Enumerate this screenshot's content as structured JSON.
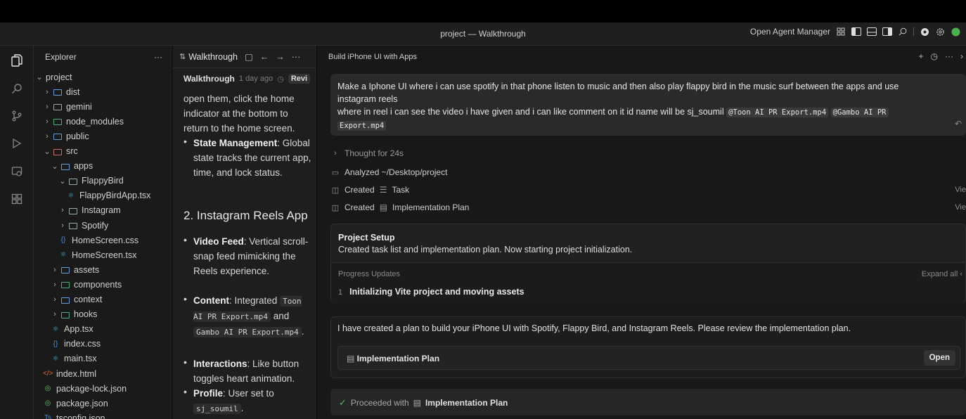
{
  "window": {
    "title": "project — Walkthrough",
    "open_agent_manager": "Open Agent Manager"
  },
  "explorer": {
    "title": "Explorer",
    "more": "···",
    "tree": [
      {
        "label": "project",
        "depth": 0,
        "kind": "folder-open"
      },
      {
        "label": "dist",
        "depth": 1,
        "kind": "folder"
      },
      {
        "label": "gemini",
        "depth": 1,
        "kind": "folder"
      },
      {
        "label": "node_modules",
        "depth": 1,
        "kind": "folder"
      },
      {
        "label": "public",
        "depth": 1,
        "kind": "folder"
      },
      {
        "label": "src",
        "depth": 1,
        "kind": "folder-open"
      },
      {
        "label": "apps",
        "depth": 2,
        "kind": "folder-open"
      },
      {
        "label": "FlappyBird",
        "depth": 3,
        "kind": "folder-open"
      },
      {
        "label": "FlappyBirdApp.tsx",
        "depth": 4,
        "kind": "tsx"
      },
      {
        "label": "Instagram",
        "depth": 3,
        "kind": "folder"
      },
      {
        "label": "Spotify",
        "depth": 3,
        "kind": "folder"
      },
      {
        "label": "HomeScreen.css",
        "depth": 3,
        "kind": "css"
      },
      {
        "label": "HomeScreen.tsx",
        "depth": 3,
        "kind": "tsx"
      },
      {
        "label": "assets",
        "depth": 2,
        "kind": "folder"
      },
      {
        "label": "components",
        "depth": 2,
        "kind": "folder"
      },
      {
        "label": "context",
        "depth": 2,
        "kind": "folder"
      },
      {
        "label": "hooks",
        "depth": 2,
        "kind": "folder"
      },
      {
        "label": "App.tsx",
        "depth": 2,
        "kind": "tsx"
      },
      {
        "label": "index.css",
        "depth": 2,
        "kind": "css"
      },
      {
        "label": "main.tsx",
        "depth": 2,
        "kind": "tsx"
      },
      {
        "label": "index.html",
        "depth": 1,
        "kind": "html"
      },
      {
        "label": "package-lock.json",
        "depth": 1,
        "kind": "json"
      },
      {
        "label": "package.json",
        "depth": 1,
        "kind": "json"
      },
      {
        "label": "tsconfig.json",
        "depth": 1,
        "kind": "ts"
      }
    ]
  },
  "walkthrough": {
    "tab_label": "Walkthrough",
    "heading": "Walkthrough",
    "ago": "1 day ago",
    "review": "Revi",
    "para1": "open them, click the home indicator at the bottom to return to the home screen.",
    "state_title": "State Management",
    "state_text": ": Global state tracks the current app, time, and lock status.",
    "section2": "2. Instagram Reels App",
    "video_title": "Video Feed",
    "video_text": ": Vertical scroll-snap feed mimicking the Reels experience.",
    "content_title": "Content",
    "content_text": ": Integrated",
    "content_code1": "Toon AI PR Export.mp4",
    "content_and": "and",
    "content_code2": "Gambo AI PR Export.mp4",
    "content_end": ".",
    "interactions_title": "Interactions",
    "interactions_text": ": Like button toggles heart animation.",
    "profile_title": "Profile",
    "profile_text": ": User set to",
    "profile_code": "sj_soumil",
    "profile_end": "."
  },
  "agent": {
    "title": "Build iPhone UI with Apps",
    "prompt_line1": "Make a Iphone UI where i can use spotify in  that phone listen to music and then also play flappy bird in the music surf between the apps and use",
    "prompt_line2": "instagram reels",
    "prompt_line3": "where in reel i can see the video i have given and i can like comment on it id name will be sj_soumil",
    "prompt_file1": "@Toon AI PR Export.mp4",
    "prompt_file2": "@Gambo AI PR",
    "prompt_file2b": "Export.mp4",
    "thought": "Thought for 24s",
    "analyzed": "Analyzed ~/Desktop/project",
    "created1_prefix": "Created",
    "created1_item": "Task",
    "created2_prefix": "Created",
    "created2_item": "Implementation Plan",
    "view": "Vie",
    "setup_title": "Project Setup",
    "setup_desc": "Created task list and implementation plan. Now starting project initialization.",
    "progress_label": "Progress Updates",
    "expand_all": "Expand all",
    "progress_num": "1",
    "progress_item": "Initializing Vite project and moving assets",
    "message": "I have created a plan to build your iPhone UI with Spotify, Flappy Bird, and Instagram Reels. Please review the implementation plan.",
    "plan_label": "Implementation Plan",
    "open_btn": "Open",
    "proceeded": "Proceeded with",
    "proceeded_item": "Implementation Plan"
  }
}
